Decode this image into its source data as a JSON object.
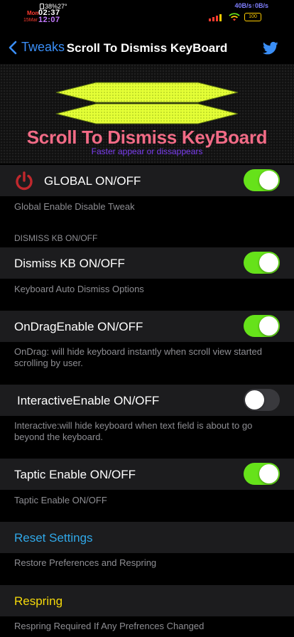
{
  "status_bar": {
    "battery_percent": "38%",
    "temperature": "27°",
    "day": "Mon",
    "time": "02:37",
    "date": "15Mar",
    "time_alt": "12:07",
    "network_speed": "40B/s↑0B/s",
    "battery_level": "100"
  },
  "nav": {
    "back_label": "Tweaks",
    "title": "Scroll To Dismiss KeyBoard"
  },
  "banner": {
    "title": "Scroll To Dismiss KeyBoard",
    "subtitle": "Faster appear or dissappears"
  },
  "settings": {
    "global": {
      "label": "GLOBAL ON/OFF",
      "on": true,
      "footer": "Global Enable Disable Tweak"
    },
    "dismiss_header": "DISMISS KB ON/OFF",
    "dismiss": {
      "label": "Dismiss KB ON/OFF",
      "on": true,
      "footer": "Keyboard Auto Dismiss Options"
    },
    "ondrag": {
      "label": "OnDragEnable ON/OFF",
      "on": true,
      "footer": "OnDrag: will hide keyboard instantly when scroll view started scrolling by user."
    },
    "interactive": {
      "label": "InteractiveEnable ON/OFF",
      "on": false,
      "footer": "Interactive:will hide keyboard when text field is about to go beyond the keyboard."
    },
    "taptic": {
      "label": "Taptic Enable ON/OFF",
      "on": true,
      "footer": "Taptic Enable ON/OFF"
    },
    "reset": {
      "label": "Reset Settings",
      "footer": "Restore Preferences and Respring"
    },
    "respring": {
      "label": "Respring",
      "footer": "Respring Required If Any Prefrences Changed"
    }
  },
  "colors": {
    "accent_blue": "#3a8ef6",
    "toggle_on": "#66e21a",
    "banner_title": "#f26b86",
    "banner_subtitle": "#7b3df0",
    "reset_link": "#30a8e8",
    "respring_link": "#f5d90a",
    "power_icon": "#c0282d"
  },
  "icons": {
    "back": "chevron-left-icon",
    "twitter": "twitter-icon",
    "power": "power-icon"
  }
}
